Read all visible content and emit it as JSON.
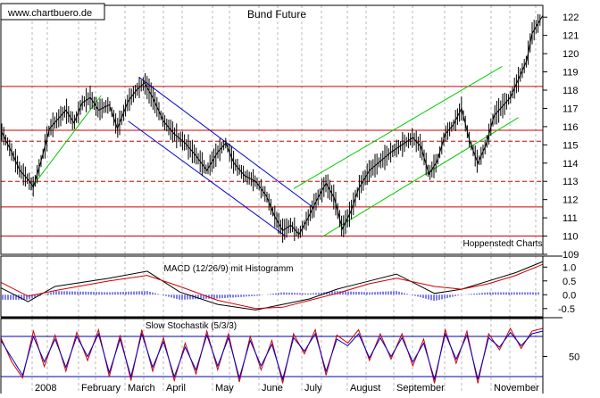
{
  "watermark": "www.chartbuero.de",
  "source_label": "Hoppenstedt Charts",
  "chart_data": [
    {
      "type": "line",
      "title": "Bund Future",
      "ylim": [
        109,
        122.5
      ],
      "yticks": [
        109,
        110,
        111,
        112,
        113,
        114,
        115,
        116,
        117,
        118,
        119,
        120,
        121,
        122
      ],
      "grid": true,
      "months": [
        "2008",
        "February",
        "March",
        "April",
        "May",
        "June",
        "July",
        "August",
        "September",
        "",
        "November"
      ],
      "horizontal_lines": [
        {
          "y": 118.2,
          "style": "solid",
          "color": "#cc0000"
        },
        {
          "y": 115.8,
          "style": "solid",
          "color": "#cc0000"
        },
        {
          "y": 115.2,
          "style": "dashed",
          "color": "#cc0000"
        },
        {
          "y": 113.0,
          "style": "dashed",
          "color": "#cc0000"
        },
        {
          "y": 111.6,
          "style": "solid",
          "color": "#cc0000"
        },
        {
          "y": 110.0,
          "style": "solid",
          "color": "#cc0000"
        }
      ],
      "trend_channels": [
        {
          "color": "#00cc00",
          "x": [
            0.055,
            0.185
          ],
          "y": [
            112.6,
            117.7
          ]
        },
        {
          "color": "#0000cc",
          "x": [
            0.255,
            0.575
          ],
          "y": [
            118.7,
            111.6
          ]
        },
        {
          "color": "#0000cc",
          "x": [
            0.235,
            0.525
          ],
          "y": [
            116.3,
            110.0
          ]
        },
        {
          "color": "#00cc00",
          "x": [
            0.54,
            0.925
          ],
          "y": [
            112.6,
            119.3
          ]
        },
        {
          "color": "#00cc00",
          "x": [
            0.595,
            0.955
          ],
          "y": [
            110.0,
            116.5
          ]
        }
      ],
      "price_points": [
        [
          0.0,
          115.8
        ],
        [
          0.02,
          114.6
        ],
        [
          0.035,
          113.6
        ],
        [
          0.05,
          113.1
        ],
        [
          0.06,
          112.7
        ],
        [
          0.075,
          114.2
        ],
        [
          0.09,
          115.9
        ],
        [
          0.105,
          116.4
        ],
        [
          0.12,
          116.9
        ],
        [
          0.135,
          116.2
        ],
        [
          0.15,
          117.3
        ],
        [
          0.165,
          117.6
        ],
        [
          0.18,
          116.9
        ],
        [
          0.2,
          117.2
        ],
        [
          0.215,
          115.9
        ],
        [
          0.235,
          117.4
        ],
        [
          0.25,
          118.0
        ],
        [
          0.265,
          118.4
        ],
        [
          0.28,
          117.6
        ],
        [
          0.3,
          116.3
        ],
        [
          0.32,
          115.6
        ],
        [
          0.34,
          115.1
        ],
        [
          0.36,
          114.4
        ],
        [
          0.38,
          113.6
        ],
        [
          0.4,
          114.6
        ],
        [
          0.415,
          115.1
        ],
        [
          0.43,
          114.0
        ],
        [
          0.45,
          113.3
        ],
        [
          0.47,
          113.0
        ],
        [
          0.49,
          112.2
        ],
        [
          0.505,
          111.1
        ],
        [
          0.52,
          110.3
        ],
        [
          0.535,
          110.6
        ],
        [
          0.55,
          110.1
        ],
        [
          0.565,
          110.9
        ],
        [
          0.585,
          112.1
        ],
        [
          0.6,
          112.9
        ],
        [
          0.615,
          112.1
        ],
        [
          0.63,
          110.4
        ],
        [
          0.645,
          111.3
        ],
        [
          0.66,
          112.6
        ],
        [
          0.68,
          113.6
        ],
        [
          0.7,
          114.1
        ],
        [
          0.72,
          114.6
        ],
        [
          0.74,
          115.0
        ],
        [
          0.76,
          115.4
        ],
        [
          0.775,
          114.9
        ],
        [
          0.79,
          113.4
        ],
        [
          0.805,
          114.1
        ],
        [
          0.82,
          115.6
        ],
        [
          0.835,
          116.1
        ],
        [
          0.85,
          117.0
        ],
        [
          0.865,
          115.2
        ],
        [
          0.88,
          114.0
        ],
        [
          0.895,
          115.0
        ],
        [
          0.91,
          116.6
        ],
        [
          0.925,
          117.1
        ],
        [
          0.94,
          117.6
        ],
        [
          0.955,
          118.6
        ],
        [
          0.97,
          119.6
        ],
        [
          0.98,
          121.1
        ],
        [
          0.99,
          121.6
        ],
        [
          1.0,
          122.1
        ]
      ]
    },
    {
      "type": "line",
      "title": "MACD (12/26/9) mit Histogramm",
      "ylim": [
        -0.7,
        1.3
      ],
      "yticks": [
        1.0,
        0.5,
        0.0,
        -0.5
      ],
      "series": [
        {
          "color": "#000000",
          "values": [
            [
              0.0,
              0.25
            ],
            [
              0.05,
              -0.25
            ],
            [
              0.1,
              0.3
            ],
            [
              0.2,
              0.6
            ],
            [
              0.27,
              0.85
            ],
            [
              0.33,
              0.1
            ],
            [
              0.4,
              -0.35
            ],
            [
              0.47,
              -0.55
            ],
            [
              0.52,
              -0.35
            ],
            [
              0.57,
              -0.15
            ],
            [
              0.62,
              0.2
            ],
            [
              0.68,
              0.5
            ],
            [
              0.73,
              0.75
            ],
            [
              0.8,
              0.05
            ],
            [
              0.85,
              0.2
            ],
            [
              0.9,
              0.5
            ],
            [
              0.95,
              0.8
            ],
            [
              1.0,
              1.2
            ]
          ]
        },
        {
          "color": "#cc0000",
          "values": [
            [
              0.0,
              0.45
            ],
            [
              0.05,
              -0.05
            ],
            [
              0.1,
              0.15
            ],
            [
              0.2,
              0.5
            ],
            [
              0.27,
              0.7
            ],
            [
              0.33,
              0.3
            ],
            [
              0.4,
              -0.2
            ],
            [
              0.47,
              -0.5
            ],
            [
              0.52,
              -0.45
            ],
            [
              0.57,
              -0.2
            ],
            [
              0.62,
              0.05
            ],
            [
              0.68,
              0.4
            ],
            [
              0.73,
              0.6
            ],
            [
              0.8,
              0.3
            ],
            [
              0.85,
              0.2
            ],
            [
              0.9,
              0.4
            ],
            [
              0.95,
              0.7
            ],
            [
              1.0,
              1.1
            ]
          ]
        }
      ],
      "histogram_color": "#0000cc"
    },
    {
      "type": "line",
      "title": "Slow Stochastik (5/3/3)",
      "ylim": [
        0,
        100
      ],
      "yticks": [
        50
      ],
      "reference_lines": [
        80,
        20
      ],
      "series": [
        {
          "color": "#cc0000",
          "values": [
            [
              0.0,
              78
            ],
            [
              0.02,
              42
            ],
            [
              0.04,
              18
            ],
            [
              0.06,
              88
            ],
            [
              0.08,
              35
            ],
            [
              0.1,
              82
            ],
            [
              0.12,
              28
            ],
            [
              0.14,
              86
            ],
            [
              0.16,
              44
            ],
            [
              0.18,
              90
            ],
            [
              0.2,
              20
            ],
            [
              0.22,
              82
            ],
            [
              0.24,
              14
            ],
            [
              0.26,
              90
            ],
            [
              0.28,
              28
            ],
            [
              0.3,
              78
            ],
            [
              0.32,
              14
            ],
            [
              0.34,
              70
            ],
            [
              0.36,
              24
            ],
            [
              0.38,
              88
            ],
            [
              0.4,
              30
            ],
            [
              0.42,
              84
            ],
            [
              0.44,
              12
            ],
            [
              0.46,
              80
            ],
            [
              0.48,
              30
            ],
            [
              0.5,
              74
            ],
            [
              0.52,
              10
            ],
            [
              0.54,
              84
            ],
            [
              0.56,
              54
            ],
            [
              0.58,
              90
            ],
            [
              0.6,
              22
            ],
            [
              0.62,
              82
            ],
            [
              0.64,
              70
            ],
            [
              0.66,
              90
            ],
            [
              0.68,
              44
            ],
            [
              0.7,
              84
            ],
            [
              0.72,
              46
            ],
            [
              0.74,
              84
            ],
            [
              0.76,
              36
            ],
            [
              0.78,
              76
            ],
            [
              0.8,
              10
            ],
            [
              0.82,
              90
            ],
            [
              0.84,
              40
            ],
            [
              0.86,
              88
            ],
            [
              0.88,
              10
            ],
            [
              0.9,
              84
            ],
            [
              0.92,
              60
            ],
            [
              0.94,
              92
            ],
            [
              0.96,
              62
            ],
            [
              0.98,
              88
            ],
            [
              1.0,
              92
            ]
          ]
        },
        {
          "color": "#0000cc",
          "values": [
            [
              0.0,
              74
            ],
            [
              0.02,
              48
            ],
            [
              0.04,
              22
            ],
            [
              0.06,
              80
            ],
            [
              0.08,
              42
            ],
            [
              0.1,
              76
            ],
            [
              0.12,
              34
            ],
            [
              0.14,
              80
            ],
            [
              0.16,
              50
            ],
            [
              0.18,
              84
            ],
            [
              0.2,
              26
            ],
            [
              0.22,
              76
            ],
            [
              0.24,
              20
            ],
            [
              0.26,
              84
            ],
            [
              0.28,
              34
            ],
            [
              0.3,
              72
            ],
            [
              0.32,
              20
            ],
            [
              0.34,
              64
            ],
            [
              0.36,
              30
            ],
            [
              0.38,
              82
            ],
            [
              0.4,
              36
            ],
            [
              0.42,
              78
            ],
            [
              0.44,
              18
            ],
            [
              0.46,
              74
            ],
            [
              0.48,
              36
            ],
            [
              0.5,
              68
            ],
            [
              0.52,
              16
            ],
            [
              0.54,
              78
            ],
            [
              0.56,
              58
            ],
            [
              0.58,
              84
            ],
            [
              0.6,
              28
            ],
            [
              0.62,
              76
            ],
            [
              0.64,
              66
            ],
            [
              0.66,
              84
            ],
            [
              0.68,
              48
            ],
            [
              0.7,
              78
            ],
            [
              0.72,
              50
            ],
            [
              0.74,
              78
            ],
            [
              0.76,
              42
            ],
            [
              0.78,
              70
            ],
            [
              0.8,
              16
            ],
            [
              0.82,
              84
            ],
            [
              0.84,
              46
            ],
            [
              0.86,
              82
            ],
            [
              0.88,
              16
            ],
            [
              0.9,
              78
            ],
            [
              0.92,
              64
            ],
            [
              0.94,
              86
            ],
            [
              0.96,
              66
            ],
            [
              0.98,
              84
            ],
            [
              1.0,
              88
            ]
          ]
        }
      ]
    }
  ]
}
